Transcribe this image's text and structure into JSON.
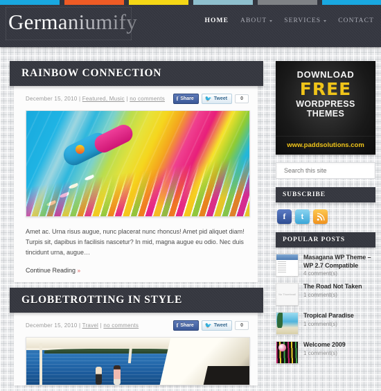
{
  "topbar": {
    "colors": [
      "#19a8e0",
      "#ef5b25",
      "#f5d715",
      "#8fc0ce",
      "#7f8286"
    ],
    "gap_color": "#33363f"
  },
  "header": {
    "logo": "Germaniumify",
    "nav": [
      {
        "label": "HOME",
        "active": true,
        "has_caret": false
      },
      {
        "label": "ABOUT",
        "active": false,
        "has_caret": true
      },
      {
        "label": "SERVICES",
        "active": false,
        "has_caret": true
      },
      {
        "label": "CONTACT",
        "active": false,
        "has_caret": false
      }
    ]
  },
  "posts": [
    {
      "title": "RAINBOW CONNECTION",
      "date": "December 15, 2010",
      "categories": "Featured, Music",
      "comments": "no comments",
      "meta_sep": " | ",
      "share": {
        "facebook": "Share",
        "twitter": "Tweet",
        "count": "0"
      },
      "excerpt": "Amet ac. Urna risus augue, nunc placerat nunc rhoncus! Amet pid aliquet diam! Turpis sit, dapibus in facilisis nascetur? In mid, magna augue eu odio. Nec duis tincidunt urna, augue…",
      "more": "Continue Reading",
      "more_arrow": "»"
    },
    {
      "title": "GLOBETROTTING IN STYLE",
      "date": "December 15, 2010",
      "categories": "Travel",
      "comments": "no comments",
      "meta_sep": " | ",
      "share": {
        "facebook": "Share",
        "twitter": "Tweet",
        "count": "0"
      }
    }
  ],
  "sidebar": {
    "ad": {
      "line1": "DOWNLOAD",
      "line2": "FREE",
      "line3": "WORDPRESS",
      "line4": "THEMES",
      "url": "www.paddsolutions.com",
      "accent": "#f0c419"
    },
    "search": {
      "placeholder": "Search this site",
      "value": ""
    },
    "subscribe": {
      "title": "SUBSCRIBE",
      "icons": [
        {
          "name": "facebook",
          "glyph": "f",
          "color": "#3b5998"
        },
        {
          "name": "twitter",
          "glyph": "t",
          "color": "#3ba7d8"
        },
        {
          "name": "rss",
          "glyph": "◔",
          "color": "#f0921f"
        }
      ]
    },
    "popular": {
      "title": "POPULAR POSTS",
      "items": [
        {
          "title": "Masagana WP Theme – WP 2.7 Compatible",
          "comments": "4 comment(s)",
          "thumb": "masagana"
        },
        {
          "title": "The Road Not Taken",
          "comments": "1 comment(s)",
          "thumb": "no-thumbnail",
          "thumb_label": "No Thumbnail"
        },
        {
          "title": "Tropical Paradise",
          "comments": "1 comment(s)",
          "thumb": "tropical"
        },
        {
          "title": "Welcome 2009",
          "comments": "1 comment(s)",
          "thumb": "welcome"
        }
      ]
    }
  }
}
